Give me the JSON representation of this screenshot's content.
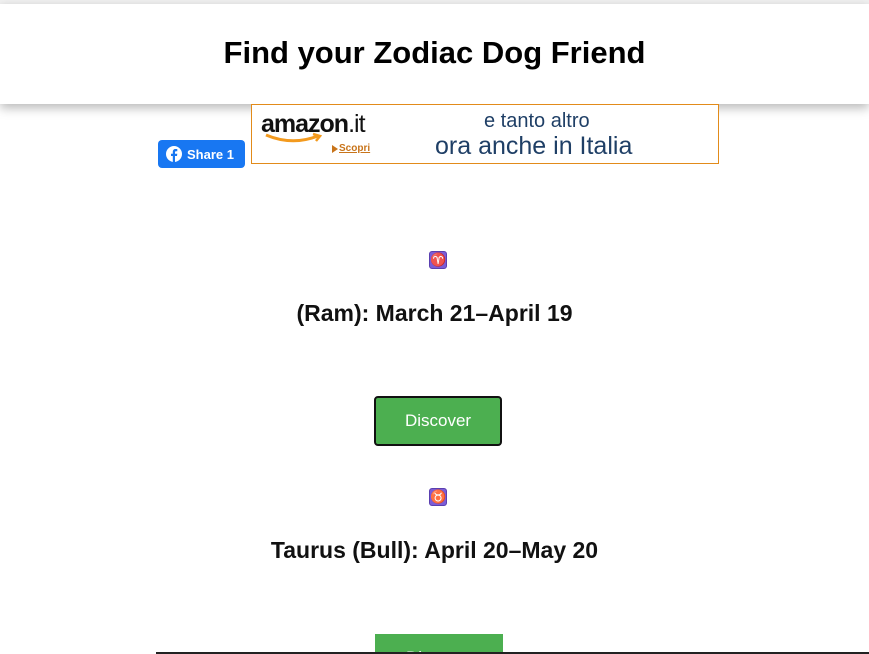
{
  "header": {
    "title": "Find your Zodiac Dog Friend"
  },
  "share": {
    "label": "Share 1",
    "icon": "facebook-icon",
    "color": "#1877f2"
  },
  "ad": {
    "brand": "amazon",
    "brand_suffix": ".it",
    "link": "Scopri",
    "line1": "e tanto altro",
    "line2_a": "ora anche ",
    "line2_b": "in Italia",
    "border_color": "#e28b1a"
  },
  "signs": [
    {
      "symbol": "♈",
      "icon": "aries-icon",
      "title": "(Ram): March 21–April 19",
      "button": "Discover"
    },
    {
      "symbol": "♉",
      "icon": "taurus-icon",
      "title": "Taurus (Bull): April 20–May 20",
      "button": "Discover"
    }
  ],
  "colors": {
    "button": "#4caf50",
    "zodiac_icon": "#7b5cd6"
  }
}
